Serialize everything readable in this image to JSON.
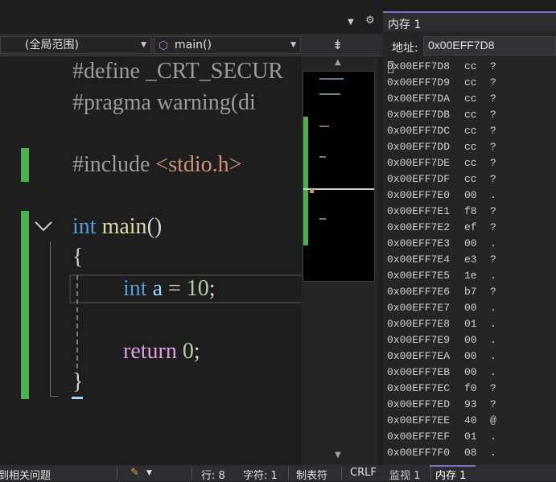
{
  "nav": {
    "scope": "(全局范围)",
    "member": "main()"
  },
  "code": {
    "line1_kw": "#define _CRT_SECUR",
    "line2_kw": "#pragma warning(di",
    "line4_kw": "#include ",
    "line4_str": "<stdio.h>",
    "line6_type": "int",
    "line6_fn": "main",
    "line6_paren": "()",
    "line7": "{",
    "line8_type": "int",
    "line8_var": "a",
    "line8_eq": " = ",
    "line8_num": "10",
    "line8_semi": ";",
    "line10_kw": "return",
    "line10_num": "0",
    "line10_semi": ";",
    "line11": "}"
  },
  "memory": {
    "tab_title": "内存 1",
    "address_label": "地址:",
    "address_value": "0x00EFF7D8",
    "rows": [
      {
        "addr": "0x00EFF7D8",
        "hex": "cc",
        "ch": "?"
      },
      {
        "addr": "0x00EFF7D9",
        "hex": "cc",
        "ch": "?"
      },
      {
        "addr": "0x00EFF7DA",
        "hex": "cc",
        "ch": "?"
      },
      {
        "addr": "0x00EFF7DB",
        "hex": "cc",
        "ch": "?"
      },
      {
        "addr": "0x00EFF7DC",
        "hex": "cc",
        "ch": "?"
      },
      {
        "addr": "0x00EFF7DD",
        "hex": "cc",
        "ch": "?"
      },
      {
        "addr": "0x00EFF7DE",
        "hex": "cc",
        "ch": "?"
      },
      {
        "addr": "0x00EFF7DF",
        "hex": "cc",
        "ch": "?"
      },
      {
        "addr": "0x00EFF7E0",
        "hex": "00",
        "ch": "."
      },
      {
        "addr": "0x00EFF7E1",
        "hex": "f8",
        "ch": "?"
      },
      {
        "addr": "0x00EFF7E2",
        "hex": "ef",
        "ch": "?"
      },
      {
        "addr": "0x00EFF7E3",
        "hex": "00",
        "ch": "."
      },
      {
        "addr": "0x00EFF7E4",
        "hex": "e3",
        "ch": "?"
      },
      {
        "addr": "0x00EFF7E5",
        "hex": "1e",
        "ch": "."
      },
      {
        "addr": "0x00EFF7E6",
        "hex": "b7",
        "ch": "?"
      },
      {
        "addr": "0x00EFF7E7",
        "hex": "00",
        "ch": "."
      },
      {
        "addr": "0x00EFF7E8",
        "hex": "01",
        "ch": "."
      },
      {
        "addr": "0x00EFF7E9",
        "hex": "00",
        "ch": "."
      },
      {
        "addr": "0x00EFF7EA",
        "hex": "00",
        "ch": "."
      },
      {
        "addr": "0x00EFF7EB",
        "hex": "00",
        "ch": "."
      },
      {
        "addr": "0x00EFF7EC",
        "hex": "f0",
        "ch": "?"
      },
      {
        "addr": "0x00EFF7ED",
        "hex": "93",
        "ch": "?"
      },
      {
        "addr": "0x00EFF7EE",
        "hex": "40",
        "ch": "@"
      },
      {
        "addr": "0x00EFF7EF",
        "hex": "01",
        "ch": "."
      },
      {
        "addr": "0x00EFF7F0",
        "hex": "08",
        "ch": "."
      }
    ]
  },
  "status": {
    "issues": "到相关问题",
    "line": "行: 8",
    "col": "字符: 1",
    "indent": "制表符",
    "eol": "CRLF"
  },
  "bottom_tabs": [
    "监视 1",
    "内存 1"
  ],
  "icons": {
    "dropdown": "triangle-down",
    "settings": "gear",
    "split": "split-view",
    "scope": "cube",
    "collapse": "chevron-down",
    "brush": "broom"
  }
}
